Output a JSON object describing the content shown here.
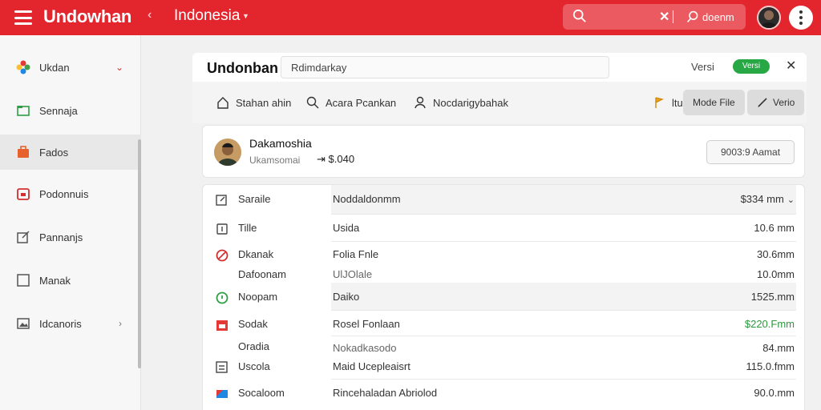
{
  "topbar": {
    "brand": "Undowhan",
    "region": "Indonesia",
    "search_label": "doenm"
  },
  "sidebar": {
    "items": [
      {
        "label": "Ukdan"
      },
      {
        "label": "Sennaja"
      },
      {
        "label": "Fados"
      },
      {
        "label": "Podonnuis"
      },
      {
        "label": "Pannanjs"
      },
      {
        "label": "Manak"
      },
      {
        "label": "Idcanoris"
      }
    ]
  },
  "panel": {
    "title": "Undonban",
    "input_value": "Rdimdarkay",
    "versi_label": "Versi",
    "versi_badge": "Versi"
  },
  "toolbar": {
    "home_label": "Stahan ahin",
    "search_label": "Acara Pcankan",
    "user_label": "Nocdarigybahak",
    "flag_label": "ltu",
    "mode_label": "Mode File",
    "verio_label": "Verio"
  },
  "profile": {
    "name": "Dakamoshia",
    "sub": "Ukamsomai",
    "amount": "$.040",
    "button": "9003:9 Aamat"
  },
  "table": {
    "rows": [
      {
        "label": "Saraile",
        "value": "Noddaldonmm",
        "amount": "$334 mm"
      },
      {
        "label": "Tille",
        "value": "Usida",
        "amount": "10.6 mm"
      },
      {
        "label": "Dkanak",
        "value": "Folia Fnle",
        "amount": "30.6mm"
      },
      {
        "label": "Dafoonam",
        "value": "UlJOlale",
        "amount": "10.0mm"
      },
      {
        "label": "Noopam",
        "value": "Daiko",
        "amount": "1525.mm"
      },
      {
        "label": "Sodak",
        "value": "Rosel Fonlaan",
        "amount": "$220.Fmm"
      },
      {
        "label": "Oradia",
        "value": "Nokadkasodo",
        "amount": "84.mm"
      },
      {
        "label": "Uscola",
        "value": "Maid Ucepleaisrt",
        "amount": "115.0.fmm"
      },
      {
        "label": "Socaloom",
        "value": "Rincehaladan Abriolod",
        "amount": "90.0.mm"
      }
    ]
  },
  "colors": {
    "brand_red": "#e3262e",
    "badge_green": "#28a745",
    "amount_green": "#2a9a3c"
  }
}
